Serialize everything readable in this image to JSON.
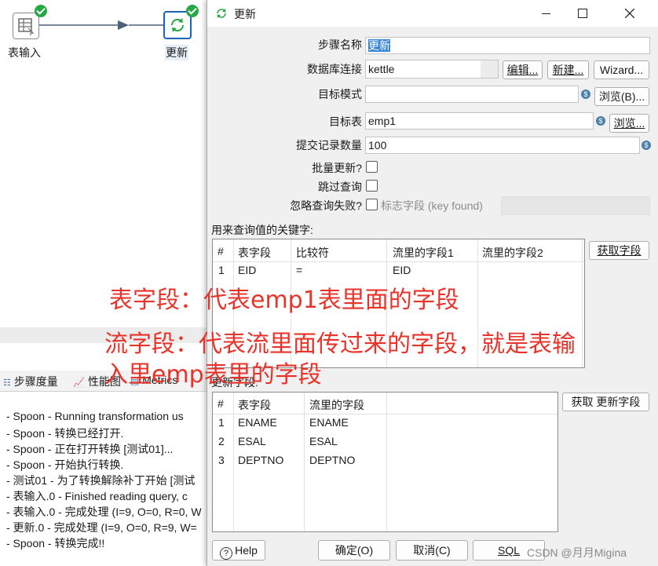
{
  "canvas": {
    "nodes": [
      {
        "label": "表输入"
      },
      {
        "label": "更新"
      }
    ]
  },
  "bottom_panel": {
    "tabs": [
      "步骤度量",
      "性能图",
      "Metrics"
    ],
    "log_lines": [
      "- Spoon - Running transformation us",
      "- Spoon - 转换已经打开.",
      "- Spoon - 正在打开转换 [测试01]...",
      "- Spoon - 开始执行转换.",
      "- 测试01 - 为了转换解除补丁开始  [测试",
      "- 表输入.0 - Finished reading query, c",
      "- 表输入.0 - 完成处理 (I=9, O=0, R=0, W",
      "- 更新.0 - 完成处理 (I=9, O=0, R=9, W=",
      "- Spoon - 转换完成!!"
    ]
  },
  "dialog": {
    "title": "更新",
    "step_name_label": "步骤名称",
    "step_name_value": "更新",
    "db_conn_label": "数据库连接",
    "db_conn_value": "kettle",
    "edit_button": "编辑...",
    "new_button": "新建...",
    "wizard_button": "Wizard...",
    "target_schema_label": "目标模式",
    "target_schema_value": "",
    "browse_b_button": "浏览(B)...",
    "target_table_label": "目标表",
    "target_table_value": "emp1",
    "browse_button": "浏览...",
    "commit_size_label": "提交记录数量",
    "commit_size_value": "100",
    "batch_update_label": "批量更新?",
    "skip_lookup_label": "跳过查询",
    "ignore_lookup_fail_label": "忽略查询失败?",
    "flag_field_label": "标志字段 (key found)",
    "key_section_label": "用来查询值的关键字:",
    "key_table": {
      "headers": [
        "#",
        "表字段",
        "比较符",
        "流里的字段1",
        "流里的字段2"
      ],
      "rows": [
        [
          "1",
          "EID",
          "=",
          "EID",
          ""
        ]
      ]
    },
    "get_fields_button": "获取字段",
    "update_section_label": "更新字段:",
    "update_table": {
      "headers": [
        "#",
        "表字段",
        "流里的字段"
      ],
      "rows": [
        [
          "1",
          "ENAME",
          "ENAME"
        ],
        [
          "2",
          "ESAL",
          "ESAL"
        ],
        [
          "3",
          "DEPTNO",
          "DEPTNO"
        ]
      ]
    },
    "get_update_fields_button": "获取 更新字段",
    "help_button": "Help",
    "ok_button": "确定(O)",
    "cancel_button": "取消(C)",
    "sql_button": "SQL"
  },
  "annotations": {
    "line1": "表字段：代表emp1表里面的字段",
    "line2": "流字段：代表流里面传过来的字段，就是表输",
    "line3": "入里emp表里的字段"
  },
  "watermark": "CSDN @月月Migina",
  "colors": {
    "accent": "#1b64b3",
    "annotation": "#e8332a",
    "success": "#27a844"
  }
}
